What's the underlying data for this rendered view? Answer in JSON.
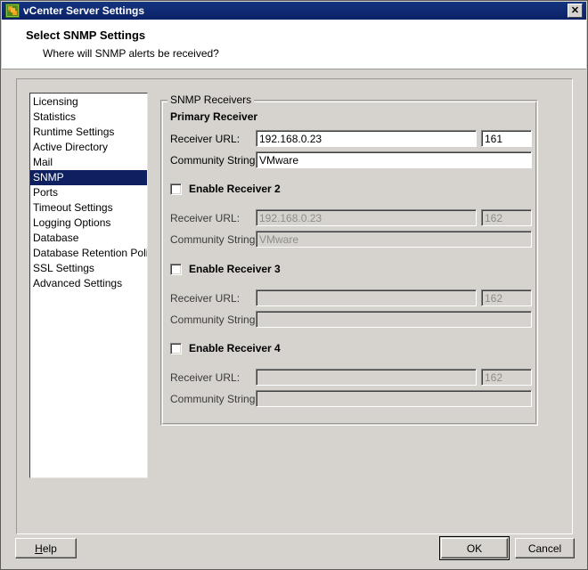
{
  "window": {
    "title": "vCenter Server Settings",
    "icon": "vcenter-icon",
    "close_label": "✕"
  },
  "header": {
    "title": "Select SNMP Settings",
    "subtitle": "Where will SNMP alerts be received?"
  },
  "sidebar": {
    "items": [
      {
        "label": "Licensing",
        "selected": false
      },
      {
        "label": "Statistics",
        "selected": false
      },
      {
        "label": "Runtime Settings",
        "selected": false
      },
      {
        "label": "Active Directory",
        "selected": false
      },
      {
        "label": "Mail",
        "selected": false
      },
      {
        "label": "SNMP",
        "selected": true
      },
      {
        "label": "Ports",
        "selected": false
      },
      {
        "label": "Timeout Settings",
        "selected": false
      },
      {
        "label": "Logging Options",
        "selected": false
      },
      {
        "label": "Database",
        "selected": false
      },
      {
        "label": "Database Retention Policy",
        "selected": false
      },
      {
        "label": "SSL Settings",
        "selected": false
      },
      {
        "label": "Advanced Settings",
        "selected": false
      }
    ]
  },
  "groupbox": {
    "legend": "SNMP Receivers"
  },
  "receivers": {
    "primary": {
      "heading": "Primary Receiver",
      "url_label": "Receiver URL:",
      "url_value": "192.168.0.23",
      "port_value": "161",
      "community_label": "Community String:",
      "community_value": "VMware",
      "enabled": true
    },
    "r2": {
      "checkbox_label": "Enable Receiver 2",
      "checked": false,
      "url_label": "Receiver URL:",
      "url_value": "192.168.0.23",
      "port_value": "162",
      "community_label": "Community String:",
      "community_value": "VMware",
      "enabled": false
    },
    "r3": {
      "checkbox_label": "Enable Receiver 3",
      "checked": false,
      "url_label": "Receiver URL:",
      "url_value": "",
      "port_value": "162",
      "community_label": "Community String:",
      "community_value": "",
      "enabled": false
    },
    "r4": {
      "checkbox_label": "Enable Receiver 4",
      "checked": false,
      "url_label": "Receiver URL:",
      "url_value": "",
      "port_value": "162",
      "community_label": "Community String:",
      "community_value": "",
      "enabled": false
    }
  },
  "buttons": {
    "help": "Help",
    "help_accel": "H",
    "help_rest": "elp",
    "ok": "OK",
    "cancel": "Cancel"
  },
  "colors": {
    "titlebar": "#0a2166",
    "selection": "#0f2060",
    "face": "#d6d3ce",
    "disabled_text": "#8d8d87"
  }
}
